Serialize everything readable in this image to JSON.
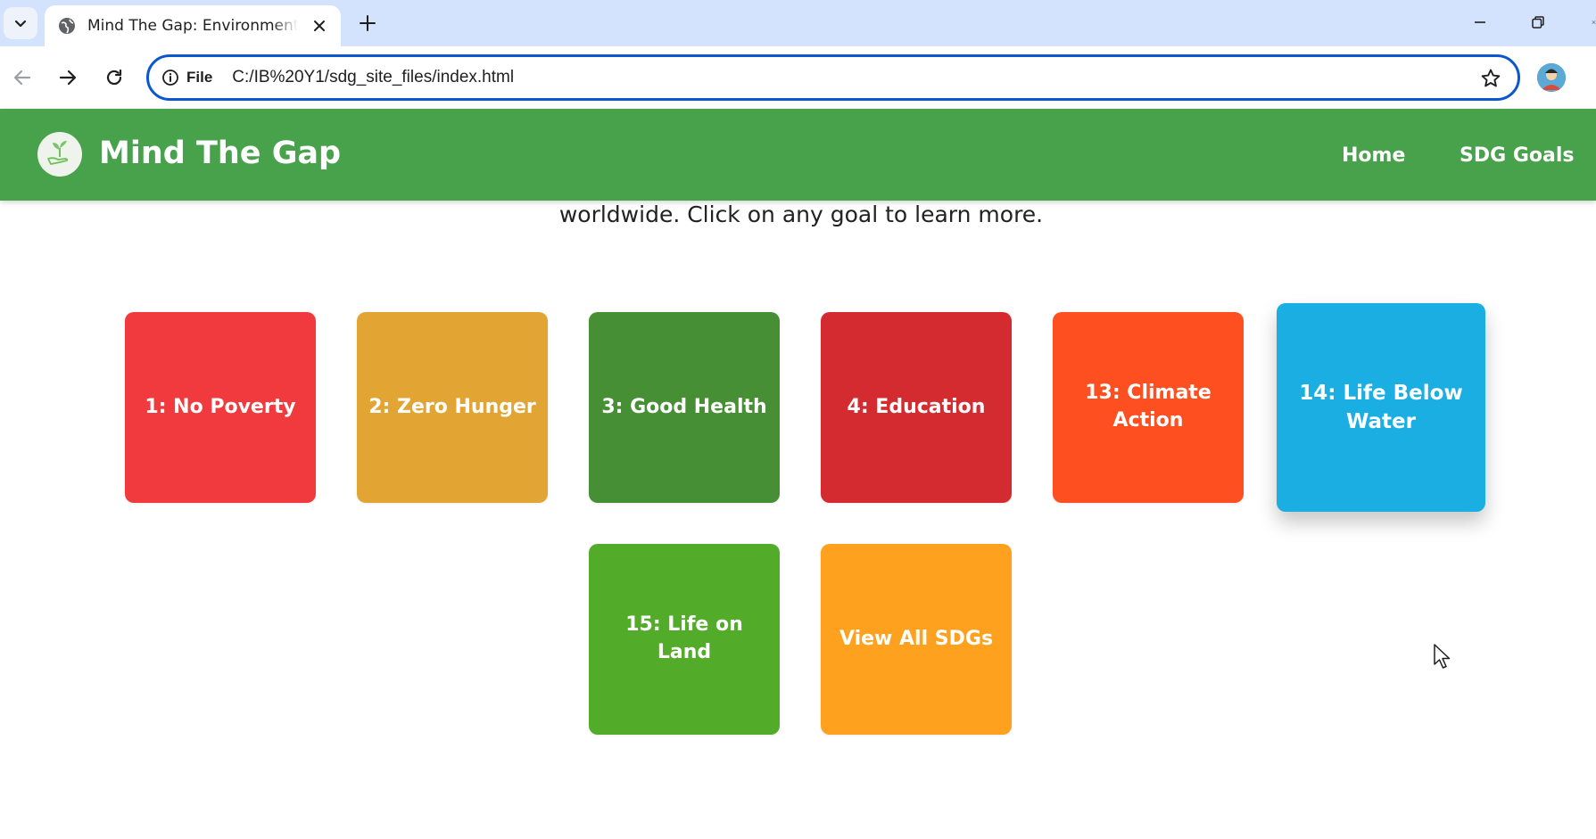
{
  "browser": {
    "tab": {
      "title": "Mind The Gap: Environmental P"
    },
    "address_bar": {
      "site_info_label": "File",
      "url": "C:/IB%20Y1/sdg_site_files/index.html"
    }
  },
  "site": {
    "brand": "Mind The Gap",
    "nav": [
      {
        "label": "Home"
      },
      {
        "label": "SDG Goals"
      }
    ],
    "intro_text": "worldwide. Click on any goal to learn more.",
    "goals": [
      {
        "label": "1: No Poverty",
        "color": "#f13a3e"
      },
      {
        "label": "2: Zero Hunger",
        "color": "#e2a534"
      },
      {
        "label": "3: Good Health",
        "color": "#478f35"
      },
      {
        "label": "4: Education",
        "color": "#d42b30"
      },
      {
        "label": "13: Climate Action",
        "color": "#fd4f1f"
      },
      {
        "label": "14: Life Below Water",
        "color": "#1aaee3"
      },
      {
        "label": "15: Life on Land",
        "color": "#52ac29"
      },
      {
        "label": "View All SDGs",
        "color": "#fda11f"
      }
    ]
  }
}
